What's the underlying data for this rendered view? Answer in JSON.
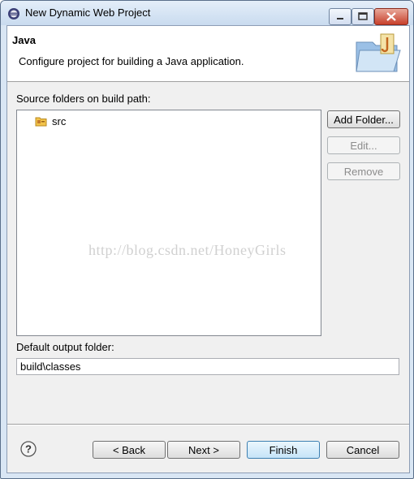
{
  "window": {
    "title": "New Dynamic Web Project"
  },
  "banner": {
    "title": "Java",
    "message": "Configure project for building a Java application."
  },
  "source_section": {
    "label": "Source folders on build path:",
    "folders": [
      {
        "name": "src",
        "icon": "source-folder-icon"
      }
    ]
  },
  "side_buttons": {
    "add": "Add Folder...",
    "edit": "Edit...",
    "remove": "Remove"
  },
  "output": {
    "label": "Default output folder:",
    "value": "build\\classes"
  },
  "watermark": "http://blog.csdn.net/HoneyGirls",
  "footer": {
    "back": "< Back",
    "next": "Next >",
    "finish": "Finish",
    "cancel": "Cancel"
  },
  "colors": {
    "accent": "#3c7fb1",
    "close_button": "#c7402b"
  }
}
